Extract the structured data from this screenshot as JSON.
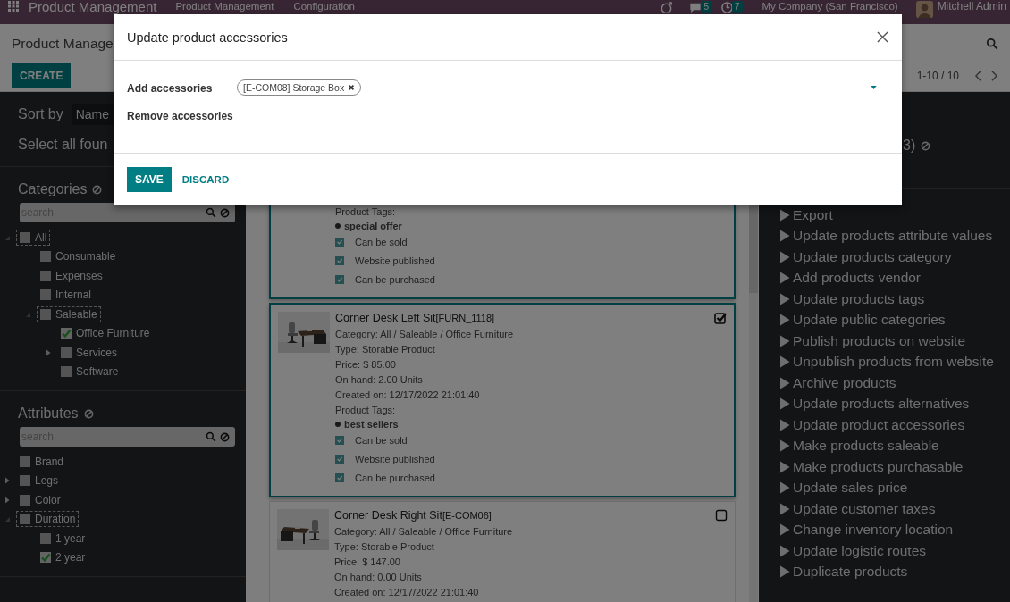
{
  "navbar": {
    "app_name": "Product Management",
    "menus": [
      "Product Management",
      "Configuration"
    ],
    "chat_count": "5",
    "activity_count": "7",
    "company": "My Company (San Francisco)",
    "user": "Mitchell Admin"
  },
  "control_panel": {
    "breadcrumb": "Product Manage",
    "create_label": "CREATE",
    "pager": "1-10 / 10"
  },
  "sidebar": {
    "sort_label": "Sort by",
    "sort_value": "Name",
    "select_all": "Select all foun",
    "sections": [
      {
        "title": "Categories",
        "search_placeholder": "search",
        "items": [
          {
            "label": "All",
            "checked": false,
            "expanded": true,
            "children": [
              {
                "label": "Consumable",
                "checked": false
              },
              {
                "label": "Expenses",
                "checked": false
              },
              {
                "label": "Internal",
                "checked": false
              },
              {
                "label": "Saleable",
                "checked": false,
                "expanded": true,
                "children": [
                  {
                    "label": "Office Furniture",
                    "checked": true
                  },
                  {
                    "label": "Services",
                    "checked": false,
                    "expanded": false
                  },
                  {
                    "label": "Software",
                    "checked": false
                  }
                ]
              }
            ]
          }
        ]
      },
      {
        "title": "Attributes",
        "search_placeholder": "search",
        "items": [
          {
            "label": "Brand",
            "checked": false
          },
          {
            "label": "Legs",
            "checked": false,
            "expanded": false
          },
          {
            "label": "Color",
            "checked": false,
            "expanded": false
          },
          {
            "label": "Duration",
            "checked": false,
            "expanded": true,
            "children": [
              {
                "label": "1 year",
                "checked": false
              },
              {
                "label": "2 year",
                "checked": true
              }
            ]
          }
        ]
      }
    ]
  },
  "cards": [
    {
      "selected": true,
      "tags_label": "Product Tags:",
      "tags": [
        "special offer"
      ],
      "flags": [
        {
          "label": "Can be sold",
          "checked": true
        },
        {
          "label": "Website published",
          "checked": true
        },
        {
          "label": "Can be purchased",
          "checked": true
        }
      ]
    },
    {
      "selected": true,
      "kind": "picture",
      "title": "Corner Desk Left Sit",
      "code": "[FURN_1118]",
      "lines": [
        "Category: All / Saleable / Office Furniture",
        "Type: Storable Product",
        "Price: $ 85.00",
        "On hand: 2.00 Units",
        "Created on: 12/17/2022 21:01:40"
      ],
      "tags_label": "Product Tags:",
      "tags": [
        "best sellers"
      ],
      "flags": [
        {
          "label": "Can be sold",
          "checked": true
        },
        {
          "label": "Website published",
          "checked": true
        },
        {
          "label": "Can be purchased",
          "checked": true
        }
      ]
    },
    {
      "selected": false,
      "kind": "picture",
      "title": "Corner Desk Right Sit",
      "code": "[E-COM06]",
      "lines": [
        "Category: All / Saleable / Office Furniture",
        "Type: Storable Product",
        "Price: $ 147.00",
        "On hand: 0.00 Units",
        "Created on: 12/17/2022 21:01:40"
      ]
    }
  ],
  "actions_panel": {
    "selection_fragment": "3)",
    "actions": [
      "Export",
      "Update products attribute values",
      "Update products category",
      "Add products vendor",
      "Update products tags",
      "Update public categories",
      "Publish products on website",
      "Unpublish products from website",
      "Archive products",
      "Update products alternatives",
      "Update product accessories",
      "Make products saleable",
      "Make products purchasable",
      "Update sales price",
      "Update customer taxes",
      "Change inventory location",
      "Update logistic routes",
      "Duplicate products"
    ]
  },
  "dialog": {
    "title": "Update product accessories",
    "fields": [
      {
        "label": "Add accessories",
        "tags": [
          "[E-COM08] Storage Box"
        ]
      },
      {
        "label": "Remove accessories"
      }
    ],
    "save_label": "SAVE",
    "discard_label": "DISCARD"
  }
}
